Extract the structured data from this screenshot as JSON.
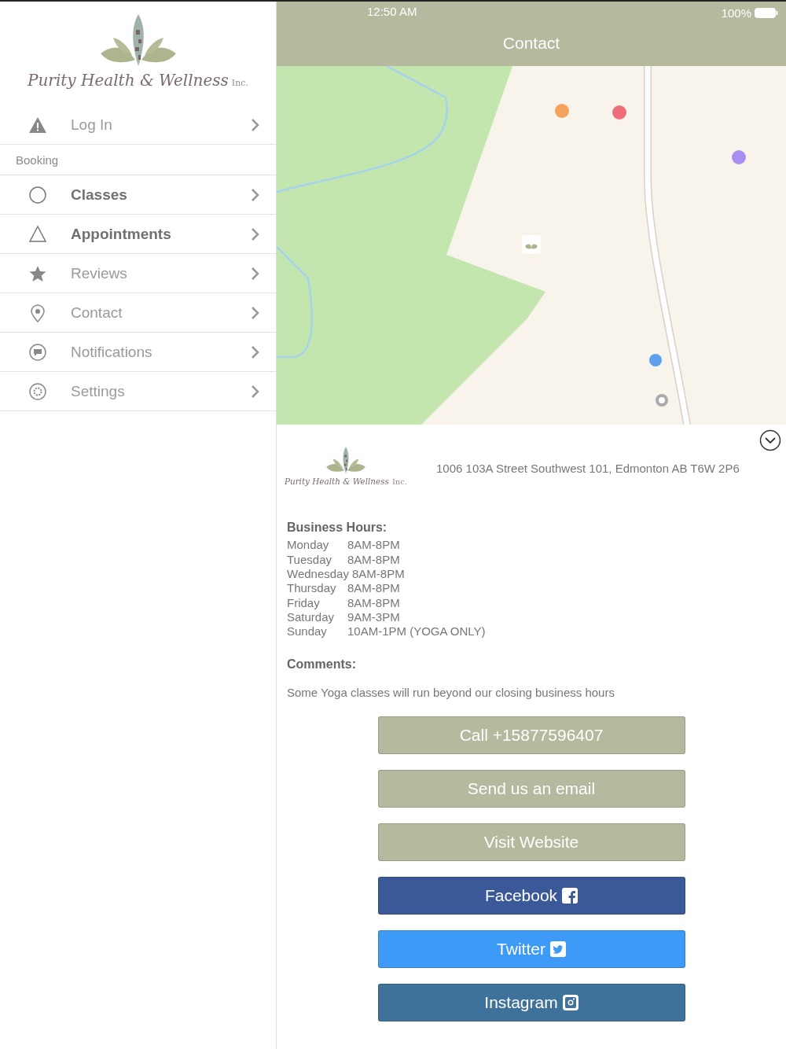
{
  "sidebar": {
    "logo": {
      "name": "Purity Health & Wellness",
      "suffix": "Inc."
    },
    "login": {
      "label": "Log In",
      "kind": "warning"
    },
    "section": "Booking",
    "items": [
      {
        "label": "Classes",
        "kind": "circle",
        "emphasis": true
      },
      {
        "label": "Appointments",
        "kind": "triangle",
        "emphasis": true
      },
      {
        "label": "Reviews",
        "kind": "star",
        "emphasis": false
      },
      {
        "label": "Contact",
        "kind": "pin",
        "emphasis": false
      },
      {
        "label": "Notifications",
        "kind": "chat",
        "emphasis": false
      },
      {
        "label": "Settings",
        "kind": "gear",
        "emphasis": false
      }
    ]
  },
  "status_bar": {
    "time": "12:50 AM",
    "battery": "100%"
  },
  "nav_bar": {
    "title": "Contact"
  },
  "contact": {
    "logo": {
      "name": "Purity Health & Wellness",
      "suffix": "Inc."
    },
    "address": "1006 103A Street Southwest 101, Edmonton AB T6W 2P6",
    "hours_title": "Business Hours:",
    "hours": [
      {
        "day": "Monday",
        "time": "8AM-8PM"
      },
      {
        "day": "Tuesday",
        "time": "8AM-8PM"
      },
      {
        "day": "Wednesday",
        "time": "8AM-8PM"
      },
      {
        "day": "Thursday",
        "time": "8AM-8PM"
      },
      {
        "day": "Friday",
        "time": "8AM-8PM"
      },
      {
        "day": "Saturday",
        "time": "9AM-3PM"
      },
      {
        "day": "Sunday",
        "time": "10AM-1PM (YOGA ONLY)"
      }
    ],
    "comments_title": "Comments:",
    "comments": "Some Yoga classes will run beyond our closing business hours",
    "buttons": [
      {
        "label": "Call +15877596407",
        "kind": "plain",
        "color": "#b5b99e"
      },
      {
        "label": "Send us an email",
        "kind": "plain",
        "color": "#b5b99e"
      },
      {
        "label": "Visit Website",
        "kind": "plain",
        "color": "#b5b99e"
      },
      {
        "label": "Facebook",
        "kind": "facebook",
        "color": "#3b5998"
      },
      {
        "label": "Twitter",
        "kind": "twitter",
        "color": "#3d9af7"
      },
      {
        "label": "Instagram",
        "kind": "instagram",
        "color": "#3f729b"
      }
    ]
  }
}
